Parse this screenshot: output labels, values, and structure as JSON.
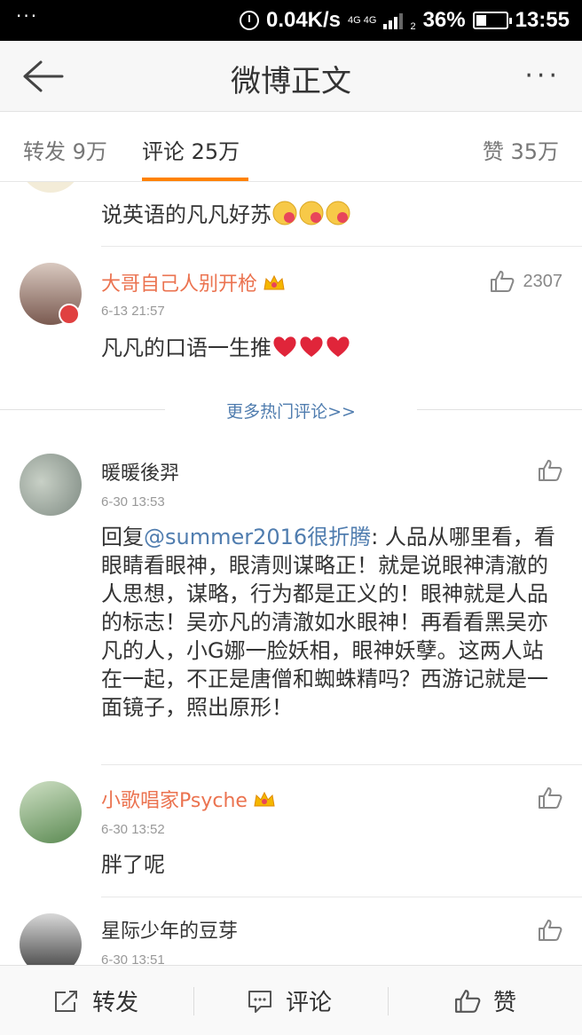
{
  "status_bar": {
    "dots": "···",
    "speed": "0.04K/s",
    "net_top": "4G 4G",
    "net_bottom": "2",
    "battery_percent_label": "36%",
    "battery_level": 0.36,
    "time": "13:55"
  },
  "nav": {
    "title": "微博正文",
    "more": "···"
  },
  "tabs": {
    "repost_label": "转发",
    "repost_count": "9万",
    "comment_label": "评论",
    "comment_count": "25万",
    "like_label": "赞",
    "like_count": "35万"
  },
  "comments": [
    {
      "text": "说英语的凡凡好苏"
    },
    {
      "name": "大哥自己人别开枪",
      "time": "6-13 21:57",
      "text": "凡凡的口语一生推",
      "likes": "2307"
    }
  ],
  "more_hot": "更多热门评论>>",
  "latest": [
    {
      "name": "暖暖後羿",
      "time": "6-30 13:53",
      "reply_prefix": "回复",
      "mention": "@summer2016很折腾",
      "text": ": 人品从哪里看，看眼睛看眼神，眼清则谋略正！就是说眼神清澈的人思想，谋略，行为都是正义的！眼神就是人品的标志！吴亦凡的清澈如水眼神！再看看黑吴亦凡的人，小G娜一脸妖相，眼神妖孽。这两人站在一起，不正是唐僧和蜘蛛精吗？西游记就是一面镜子，照出原形！"
    },
    {
      "name": "小歌唱家Psyche",
      "time": "6-30 13:52",
      "text": "胖了呢"
    },
    {
      "name": "星际少年的豆芽",
      "time": "6-30 13:51"
    }
  ],
  "bottom_bar": {
    "repost": "转发",
    "comment": "评论",
    "like": "赞"
  },
  "colors": {
    "accent": "#ff8200",
    "username_vip": "#eb7350",
    "link": "#507daf"
  }
}
